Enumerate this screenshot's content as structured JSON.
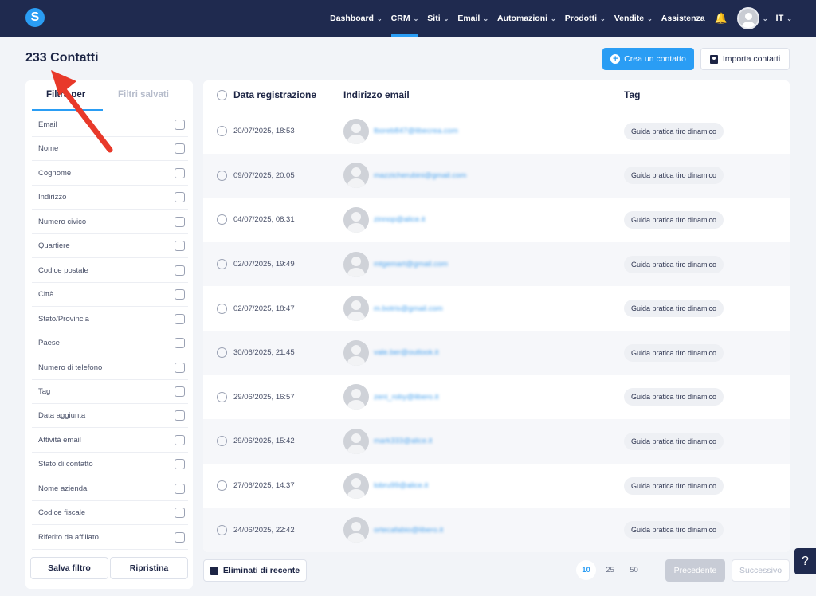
{
  "nav": {
    "logo": "S",
    "items": [
      {
        "label": "Dashboard",
        "chevron": true
      },
      {
        "label": "CRM",
        "chevron": true,
        "active": true
      },
      {
        "label": "Siti",
        "chevron": true
      },
      {
        "label": "Email",
        "chevron": true
      },
      {
        "label": "Automazioni",
        "chevron": true
      },
      {
        "label": "Prodotti",
        "chevron": true
      },
      {
        "label": "Vendite",
        "chevron": true
      },
      {
        "label": "Assistenza",
        "chevron": false
      }
    ],
    "language": "IT"
  },
  "header": {
    "title": "233 Contatti",
    "create_button": "Crea un contatto",
    "import_button": "Importa contatti"
  },
  "filters": {
    "tab_active": "Filtra per",
    "tab_saved": "Filtri salvati",
    "items": [
      "Email",
      "Nome",
      "Cognome",
      "Indirizzo",
      "Numero civico",
      "Quartiere",
      "Codice postale",
      "Città",
      "Stato/Provincia",
      "Paese",
      "Numero di telefono",
      "Tag",
      "Data aggiunta",
      "Attività email",
      "Stato di contatto",
      "Nome azienda",
      "Codice fiscale",
      "Riferito da affiliato"
    ],
    "save_button": "Salva filtro",
    "reset_button": "Ripristina"
  },
  "table": {
    "columns": [
      "Data registrazione",
      "Indirizzo email",
      "Tag"
    ],
    "rows": [
      {
        "date": "20/07/2025, 18:53",
        "email": "lboreb847@libecrea.com",
        "tag": "Guida pratica tiro dinamico"
      },
      {
        "date": "09/07/2025, 20:05",
        "email": "mazzicherubini@gmail.com",
        "tag": "Guida pratica tiro dinamico"
      },
      {
        "date": "04/07/2025, 08:31",
        "email": "zinnop@alice.it",
        "tag": "Guida pratica tiro dinamico"
      },
      {
        "date": "02/07/2025, 19:49",
        "email": "mtgemart@gmail.com",
        "tag": "Guida pratica tiro dinamico"
      },
      {
        "date": "02/07/2025, 18:47",
        "email": "m.botris@gmail.com",
        "tag": "Guida pratica tiro dinamico"
      },
      {
        "date": "30/06/2025, 21:45",
        "email": "vale.ber@outlook.it",
        "tag": "Guida pratica tiro dinamico"
      },
      {
        "date": "29/06/2025, 16:57",
        "email": "zeni_roby@libero.it",
        "tag": "Guida pratica tiro dinamico"
      },
      {
        "date": "29/06/2025, 15:42",
        "email": "mark333@alice.it",
        "tag": "Guida pratica tiro dinamico"
      },
      {
        "date": "27/06/2025, 14:37",
        "email": "lobru99@alice.it",
        "tag": "Guida pratica tiro dinamico"
      },
      {
        "date": "24/06/2025, 22:42",
        "email": "ortecafabio@libero.it",
        "tag": "Guida pratica tiro dinamico"
      }
    ]
  },
  "footer": {
    "deleted_button": "Eliminati di recente",
    "page_sizes": [
      "10",
      "25",
      "50"
    ],
    "selected_page_size": "10",
    "prev_button": "Precedente",
    "next_button": "Successivo",
    "help": "?"
  },
  "colors": {
    "nav_bg": "#1f2a4f",
    "accent": "#2a9df4",
    "annotation_arrow": "#e8392a"
  }
}
